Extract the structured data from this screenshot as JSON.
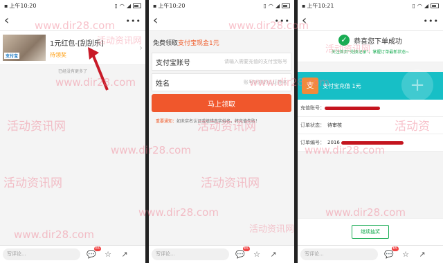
{
  "status": {
    "time1": "上午10:20",
    "time2": "上午10:20",
    "time3": "上午10:21"
  },
  "screen1": {
    "product_title": "1元红包-[刮刮乐]",
    "product_status": "待领奖",
    "thumb_label": "支付宝",
    "no_more": "已经没有更多了"
  },
  "screen2": {
    "promo_prefix": "免费领取",
    "promo_highlight": "支付宝现金1元",
    "field1_label": "支付宝账号",
    "field1_placeholder": "请输入需要充值的支付宝账号",
    "field2_label": "姓名",
    "field2_placeholder": "账号对应的认证姓名",
    "claim_button": "马上领取",
    "notice_title": "重要通知：",
    "notice_text": "如未实名认证或填错真实姓名，将充值失败！"
  },
  "screen3": {
    "success_title": "恭喜您下单成功",
    "success_sub": "关注首页\"兑换记录\"，掌握订单最新状态~",
    "card_text": "支付宝充值 1元",
    "card_icon": "支",
    "row1_label": "充值账号：",
    "row2_label": "订单状态：",
    "row2_value": "待审核",
    "row3_label": "订单编号：",
    "row3_value": "2016",
    "continue_button": "继续抽奖"
  },
  "bottom": {
    "comment_placeholder": "写评论...",
    "badge": "65"
  },
  "watermark": {
    "site": "www.dir28.com",
    "cn": "活动资讯网",
    "cn_short": "活动资"
  }
}
